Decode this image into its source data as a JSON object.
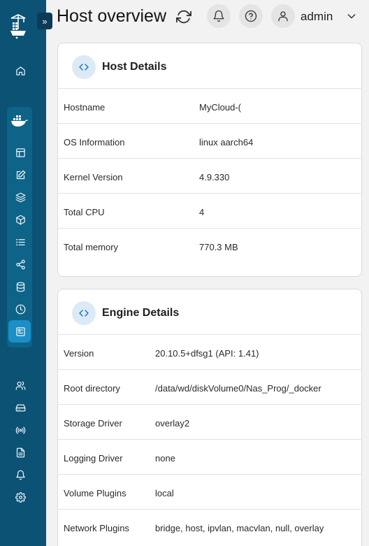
{
  "header": {
    "title": "Host overview",
    "user": "admin",
    "expand_glyph": "»"
  },
  "sidebar": {
    "items": [
      {
        "icon": "home-icon"
      },
      {
        "icon": "docker-icon"
      },
      {
        "icon": "dashboard-icon"
      },
      {
        "icon": "edit-icon"
      },
      {
        "icon": "layers-icon"
      },
      {
        "icon": "box-icon"
      },
      {
        "icon": "list-icon"
      },
      {
        "icon": "share-icon"
      },
      {
        "icon": "database-icon"
      },
      {
        "icon": "clock-icon"
      },
      {
        "icon": "host-icon"
      },
      {
        "icon": "users-icon"
      },
      {
        "icon": "drive-icon"
      },
      {
        "icon": "broadcast-icon"
      },
      {
        "icon": "file-icon"
      },
      {
        "icon": "bell-icon"
      },
      {
        "icon": "settings-icon"
      }
    ]
  },
  "host_details": {
    "title": "Host Details",
    "rows": [
      {
        "label": "Hostname",
        "value": "MyCloud-("
      },
      {
        "label": "OS Information",
        "value": "linux aarch64"
      },
      {
        "label": "Kernel Version",
        "value": "4.9.330"
      },
      {
        "label": "Total CPU",
        "value": "4"
      },
      {
        "label": "Total memory",
        "value": "770.3 MB"
      }
    ]
  },
  "engine_details": {
    "title": "Engine Details",
    "rows": [
      {
        "label": "Version",
        "value": "20.10.5+dfsg1 (API: 1.41)"
      },
      {
        "label": "Root directory",
        "value": "/data/wd/diskVolume0/Nas_Prog/_docker"
      },
      {
        "label": "Storage Driver",
        "value": "overlay2"
      },
      {
        "label": "Logging Driver",
        "value": "none"
      },
      {
        "label": "Volume Plugins",
        "value": "local"
      },
      {
        "label": "Network Plugins",
        "value": "bridge, host, ipvlan, macvlan, null, overlay"
      }
    ]
  },
  "colors": {
    "sidebar": "#0b5275",
    "sidebar_active": "#1b8fc7",
    "accent": "#1173b4"
  }
}
